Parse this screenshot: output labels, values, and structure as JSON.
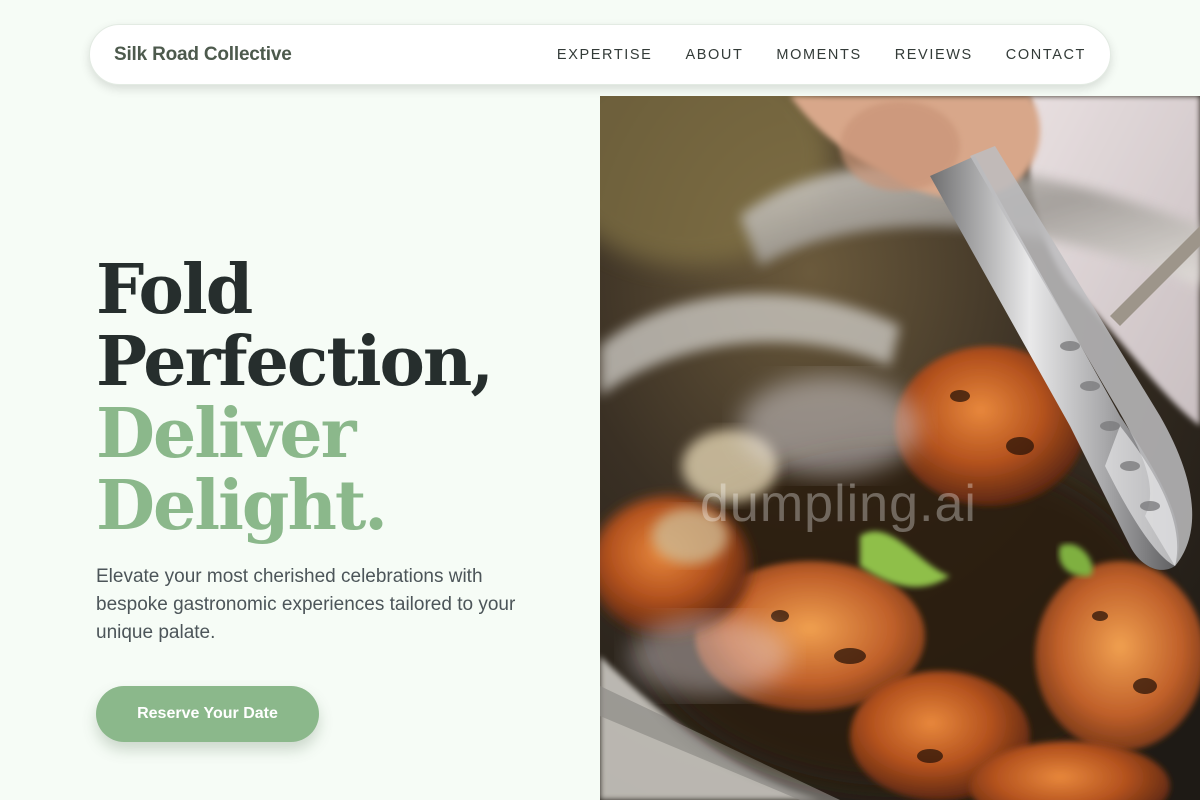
{
  "nav": {
    "brand": "Silk Road Collective",
    "links": [
      "EXPERTISE",
      "ABOUT",
      "MOMENTS",
      "REVIEWS",
      "CONTACT"
    ]
  },
  "hero": {
    "title_line1": "Fold",
    "title_line2": "Perfection,",
    "title_line3": "Deliver",
    "title_line4": "Delight.",
    "subtitle": "Elevate your most cherished celebrations with bespoke gastronomic experiences tailored to your unique palate.",
    "cta_label": "Reserve Your Date",
    "image_watermark": "dumpling.ai"
  },
  "colors": {
    "accent": "#8bb88b",
    "heading": "#262e2d",
    "background": "#f6fcf6"
  }
}
